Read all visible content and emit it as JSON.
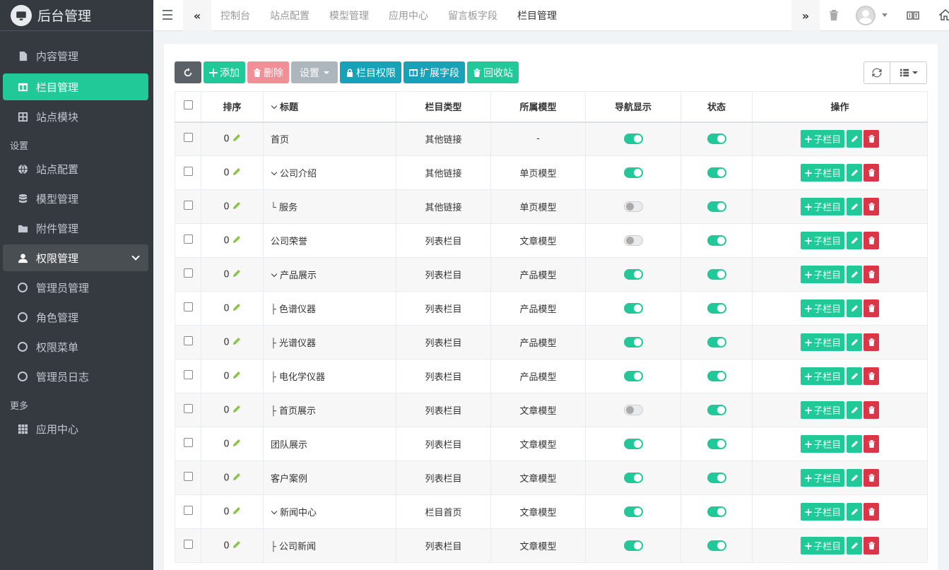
{
  "brand": {
    "title": "后台管理"
  },
  "sidebar": {
    "items": [
      {
        "label": "内容管理",
        "icon": "file-icon"
      },
      {
        "label": "栏目管理",
        "icon": "columns-icon",
        "active": true
      },
      {
        "label": "站点模块",
        "icon": "grid-icon"
      }
    ],
    "header_settings": "设置",
    "settings_items": [
      {
        "label": "站点配置",
        "icon": "globe-icon"
      },
      {
        "label": "模型管理",
        "icon": "database-icon"
      },
      {
        "label": "附件管理",
        "icon": "folder-icon"
      },
      {
        "label": "权限管理",
        "icon": "user-icon",
        "open": true
      }
    ],
    "perm_items": [
      {
        "label": "管理员管理"
      },
      {
        "label": "角色管理"
      },
      {
        "label": "权限菜单"
      },
      {
        "label": "管理员日志"
      }
    ],
    "header_more": "更多",
    "more_items": [
      {
        "label": "应用中心",
        "icon": "apps-icon"
      }
    ]
  },
  "topnav": {
    "tabs": [
      "控制台",
      "站点配置",
      "模型管理",
      "应用中心",
      "留言板字段",
      "栏目管理"
    ],
    "active_tab": "栏目管理"
  },
  "toolbar": {
    "add": "添加",
    "delete": "删除",
    "settings": "设置",
    "column_perm": "栏目权限",
    "extend_fields": "扩展字段",
    "recycle": "回收站"
  },
  "table": {
    "headers": [
      "排序",
      "标题",
      "栏目类型",
      "所属模型",
      "导航显示",
      "状态",
      "操作"
    ],
    "add_child_label": "子栏目",
    "rows": [
      {
        "sort": "0",
        "title": "首页",
        "prefix": "",
        "expand": false,
        "type": "其他链接",
        "model": "-",
        "nav": true,
        "status": true
      },
      {
        "sort": "0",
        "title": "公司介绍",
        "prefix": "",
        "expand": true,
        "type": "其他链接",
        "model": "单页模型",
        "nav": true,
        "status": true
      },
      {
        "sort": "0",
        "title": "服务",
        "prefix": "└ ",
        "expand": false,
        "type": "其他链接",
        "model": "单页模型",
        "nav": false,
        "status": true
      },
      {
        "sort": "0",
        "title": "公司荣誉",
        "prefix": "",
        "expand": false,
        "type": "列表栏目",
        "model": "文章模型",
        "nav": false,
        "status": true
      },
      {
        "sort": "0",
        "title": "产品展示",
        "prefix": "",
        "expand": true,
        "type": "列表栏目",
        "model": "产品模型",
        "nav": true,
        "status": true
      },
      {
        "sort": "0",
        "title": "色谱仪器",
        "prefix": "├ ",
        "expand": false,
        "type": "列表栏目",
        "model": "产品模型",
        "nav": true,
        "status": true
      },
      {
        "sort": "0",
        "title": "光谱仪器",
        "prefix": "├ ",
        "expand": false,
        "type": "列表栏目",
        "model": "产品模型",
        "nav": true,
        "status": true
      },
      {
        "sort": "0",
        "title": "电化学仪器",
        "prefix": "├ ",
        "expand": false,
        "type": "列表栏目",
        "model": "产品模型",
        "nav": true,
        "status": true
      },
      {
        "sort": "0",
        "title": "首页展示",
        "prefix": "├ ",
        "expand": false,
        "type": "列表栏目",
        "model": "文章模型",
        "nav": false,
        "status": true
      },
      {
        "sort": "0",
        "title": "团队展示",
        "prefix": "",
        "expand": false,
        "type": "列表栏目",
        "model": "文章模型",
        "nav": true,
        "status": true
      },
      {
        "sort": "0",
        "title": "客户案例",
        "prefix": "",
        "expand": false,
        "type": "列表栏目",
        "model": "文章模型",
        "nav": true,
        "status": true
      },
      {
        "sort": "0",
        "title": "新闻中心",
        "prefix": "",
        "expand": true,
        "type": "栏目首页",
        "model": "文章模型",
        "nav": true,
        "status": true
      },
      {
        "sort": "0",
        "title": "公司新闻",
        "prefix": "├ ",
        "expand": false,
        "type": "列表栏目",
        "model": "文章模型",
        "nav": true,
        "status": true
      }
    ]
  },
  "colors": {
    "accent": "#20c997",
    "danger": "#dc3545",
    "sidebar_bg": "#343a40"
  }
}
